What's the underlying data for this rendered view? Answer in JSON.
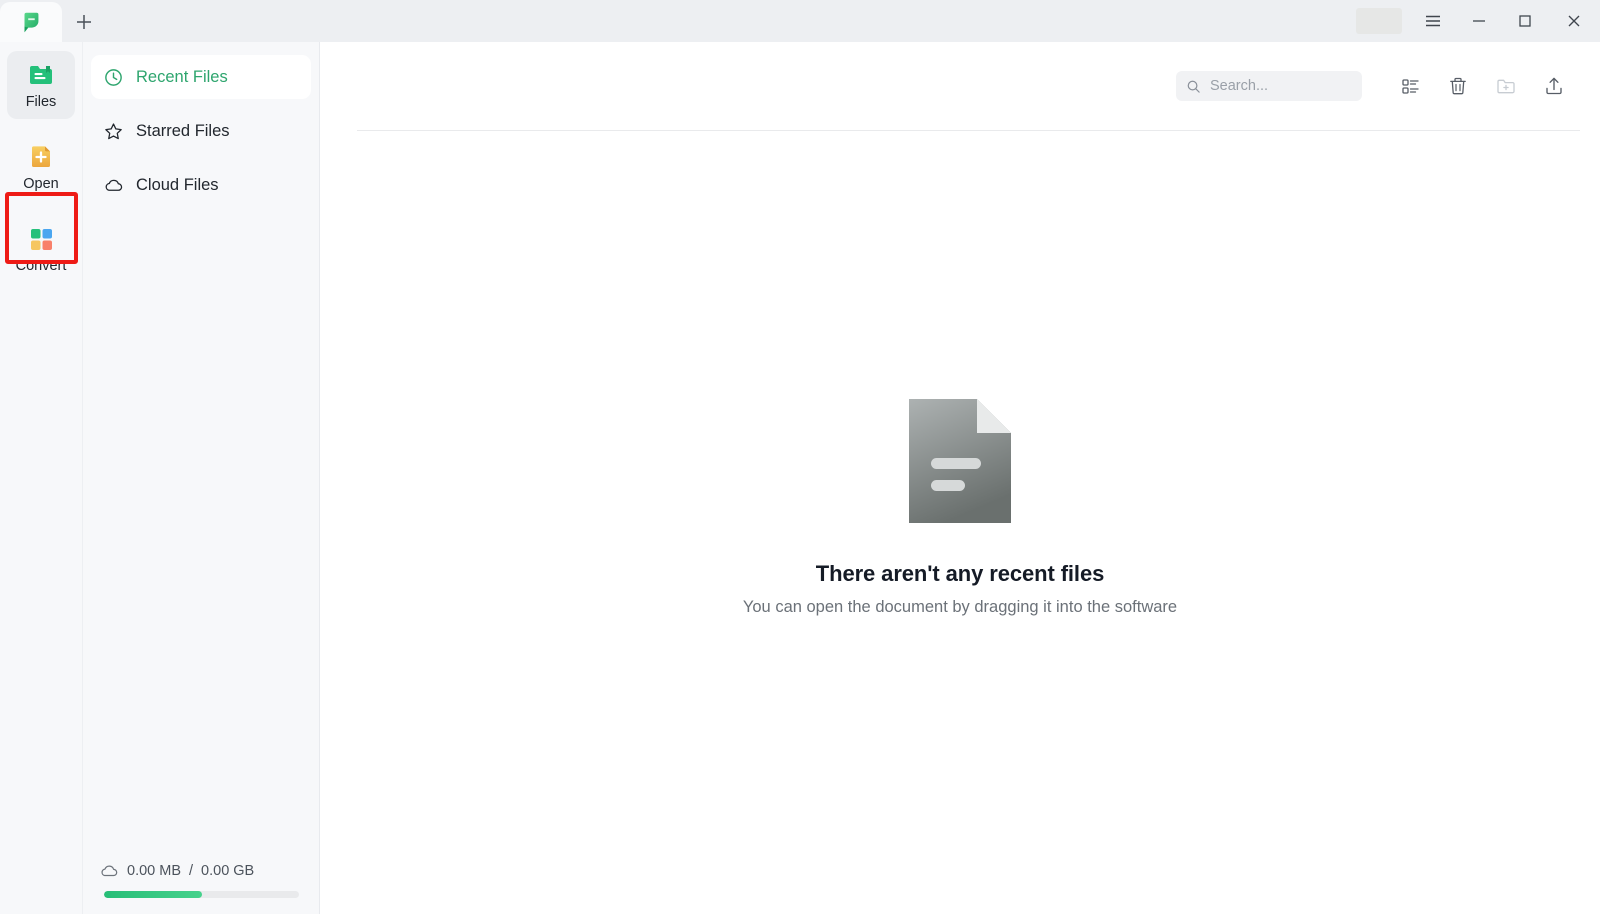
{
  "window": {
    "tab_logo_name": "app-logo",
    "new_tab_label": "+",
    "controls": {
      "menu_label": "☰",
      "minimize_label": "—",
      "maximize_label": "□",
      "close_label": "✕"
    }
  },
  "rail": {
    "items": [
      {
        "label": "Files",
        "icon": "files-icon",
        "active": true
      },
      {
        "label": "Open",
        "icon": "open-icon",
        "active": false,
        "highlighted": true
      },
      {
        "label": "Convert",
        "icon": "convert-icon",
        "active": false
      }
    ]
  },
  "nav": {
    "items": [
      {
        "label": "Recent Files",
        "icon": "clock-icon",
        "active": true
      },
      {
        "label": "Starred Files",
        "icon": "star-icon",
        "active": false
      },
      {
        "label": "Cloud Files",
        "icon": "cloud-icon",
        "active": false
      }
    ]
  },
  "storage": {
    "icon": "cloud-icon",
    "used": "0.00 MB",
    "separator": "/",
    "total": "0.00 GB",
    "progress_percent": 50
  },
  "toolbar": {
    "search": {
      "placeholder": "Search...",
      "value": ""
    },
    "buttons": [
      {
        "name": "list-view-icon",
        "label": "List view",
        "disabled": false
      },
      {
        "name": "trash-icon",
        "label": "Trash",
        "disabled": false
      },
      {
        "name": "new-folder-icon",
        "label": "New folder",
        "disabled": true
      },
      {
        "name": "upload-icon",
        "label": "Upload",
        "disabled": false
      }
    ]
  },
  "empty_state": {
    "illustration": "document-icon",
    "title": "There aren't any recent files",
    "subtitle": "You can open the document by dragging it into the software"
  },
  "colors": {
    "accent_green": "#2EA56E",
    "highlight_red": "#EE1B16",
    "titlebar_bg": "#EDEFF2",
    "panel_bg": "#F7F8FA",
    "content_bg": "#FFFFFF"
  }
}
